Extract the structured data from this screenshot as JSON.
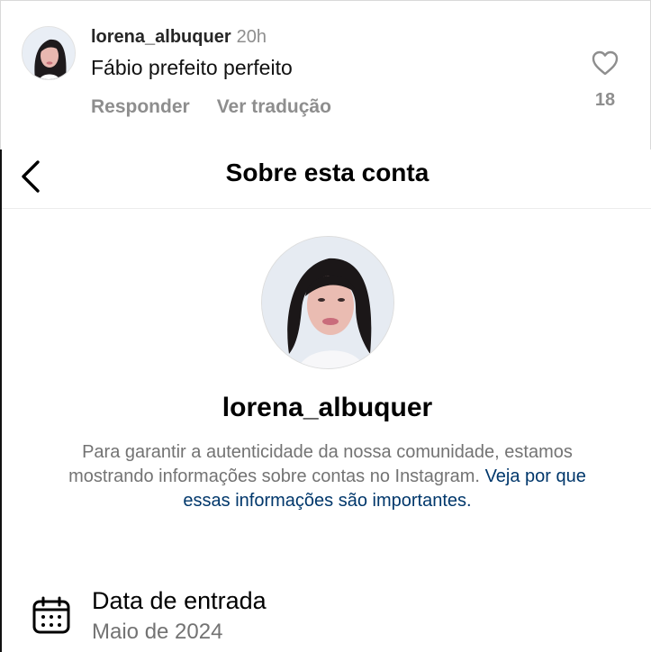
{
  "comment": {
    "username": "lorena_albuquer",
    "time": "20h",
    "text": "Fábio prefeito perfeito",
    "reply_label": "Responder",
    "translate_label": "Ver tradução",
    "likes": "18"
  },
  "about": {
    "title": "Sobre esta conta",
    "username": "lorena_albuquer",
    "description": "Para garantir a autenticidade da nossa comunidade, estamos mostrando informações sobre contas no Instagram.",
    "link_text": "Veja por que essas informações são importantes.",
    "joined_label": "Data de entrada",
    "joined_value": "Maio de 2024"
  },
  "icons": {
    "back": "chevron-left-icon",
    "like": "heart-outline-icon",
    "calendar": "calendar-icon"
  },
  "colors": {
    "muted_text": "#737373",
    "link": "#00376b"
  }
}
